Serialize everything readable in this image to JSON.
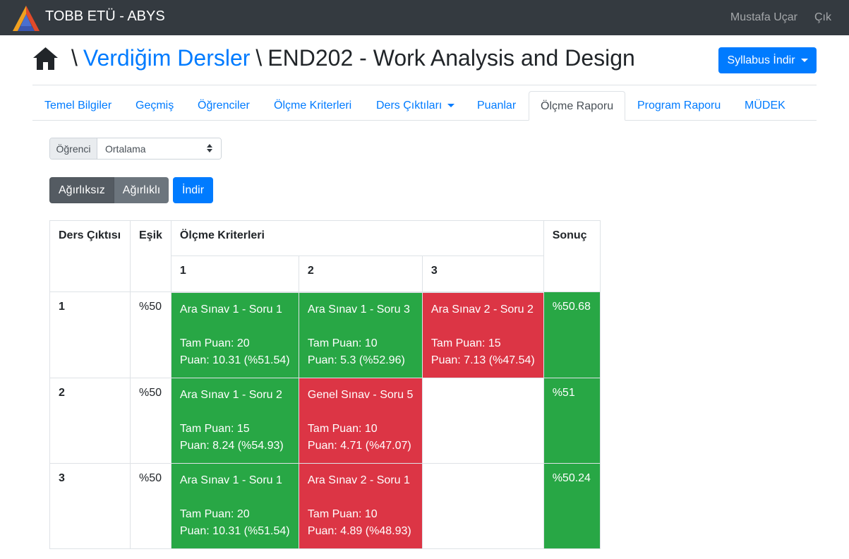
{
  "app": {
    "title": "TOBB ETÜ - ABYS",
    "user": "Mustafa Uçar",
    "logout": "Çık"
  },
  "header": {
    "sep": "\\",
    "crumb": "Verdiğim Dersler",
    "course": "END202 - Work Analysis and Design",
    "syllabus_btn": "Syllabus İndir"
  },
  "tabs": [
    "Temel Bilgiler",
    "Geçmiş",
    "Öğrenciler",
    "Ölçme Kriterleri",
    "Ders Çıktıları",
    "Puanlar",
    "Ölçme Raporu",
    "Program Raporu",
    "MÜDEK"
  ],
  "active_tab": "Ölçme Raporu",
  "student": {
    "label": "Öğrenci",
    "value": "Ortalama"
  },
  "buttons": {
    "unweighted": "Ağırlıksız",
    "weighted": "Ağırlıklı",
    "download": "İndir"
  },
  "table": {
    "headers": {
      "outcome": "Ders Çıktısı",
      "threshold": "Eşik",
      "criteria": "Ölçme Kriterleri",
      "result": "Sonuç"
    },
    "sub_headers": [
      "1",
      "2",
      "3"
    ],
    "rows": [
      {
        "outcome": "1",
        "threshold": "%50",
        "result": "%50.68",
        "cells": [
          {
            "title": "Ara Sınav 1 - Soru 1",
            "full": "Tam Puan: 20",
            "score": "Puan: 10.31 (%51.54)",
            "status": "green"
          },
          {
            "title": "Ara Sınav 1 - Soru 3",
            "full": "Tam Puan: 10",
            "score": "Puan: 5.3 (%52.96)",
            "status": "green"
          },
          {
            "title": "Ara Sınav 2 - Soru 2",
            "full": "Tam Puan: 15",
            "score": "Puan: 7.13 (%47.54)",
            "status": "red"
          }
        ]
      },
      {
        "outcome": "2",
        "threshold": "%50",
        "result": "%51",
        "cells": [
          {
            "title": "Ara Sınav 1 - Soru 2",
            "full": "Tam Puan: 15",
            "score": "Puan: 8.24 (%54.93)",
            "status": "green"
          },
          {
            "title": "Genel Sınav - Soru 5",
            "full": "Tam Puan: 10",
            "score": "Puan: 4.71 (%47.07)",
            "status": "red"
          },
          {
            "title": "",
            "full": "",
            "score": "",
            "status": "empty"
          }
        ]
      },
      {
        "outcome": "3",
        "threshold": "%50",
        "result": "%50.24",
        "cells": [
          {
            "title": "Ara Sınav 1 - Soru 1",
            "full": "Tam Puan: 20",
            "score": "Puan: 10.31 (%51.54)",
            "status": "green"
          },
          {
            "title": "Ara Sınav 2 - Soru 1",
            "full": "Tam Puan: 10",
            "score": "Puan: 4.89 (%48.93)",
            "status": "red"
          },
          {
            "title": "",
            "full": "",
            "score": "",
            "status": "empty"
          }
        ]
      }
    ]
  },
  "colors": {
    "navbar": "#343a40",
    "link": "#007bff",
    "pass": "#28a745",
    "fail": "#dc3545"
  }
}
